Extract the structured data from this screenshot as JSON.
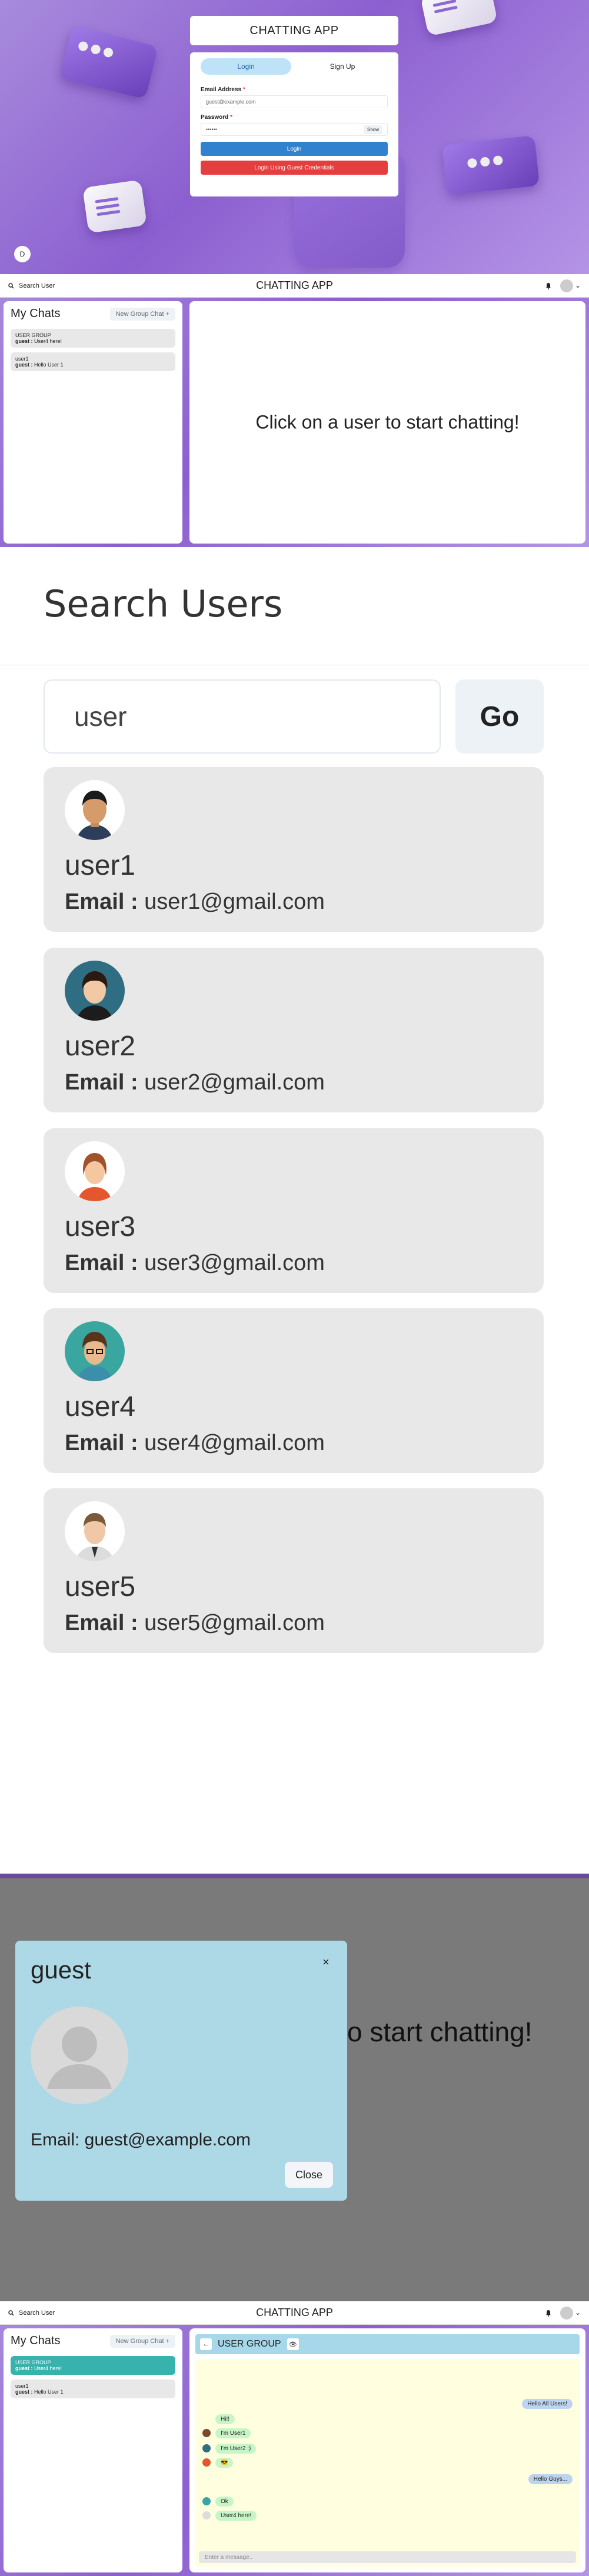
{
  "login": {
    "app_title": "CHATTING APP",
    "tabs": [
      "Login",
      "Sign Up"
    ],
    "email_label": "Email Address",
    "email_value": "guest@example.com",
    "password_label": "Password",
    "password_value": "••••••",
    "show_label": "Show",
    "login_button": "Login",
    "guest_button": "Login Using Guest Credentials",
    "required_mark": "*",
    "corner_icon": "D"
  },
  "topbar": {
    "search_label": "Search User",
    "title": "CHATTING APP",
    "bell_icon": "bell-icon",
    "avatar_icon": "avatar-icon",
    "chevron": "⌄"
  },
  "mychats": {
    "heading": "My Chats",
    "new_group_button": "New Group Chat +",
    "items": [
      {
        "name": "USER GROUP",
        "sender": "guest :",
        "message": "User4 here!"
      },
      {
        "name": "user1",
        "sender": "guest :",
        "message": "Hello User 1"
      }
    ]
  },
  "chatbox": {
    "placeholder": "Click on a user to start chatting!"
  },
  "search_users": {
    "title": "Search Users",
    "query": "user",
    "go_button": "Go",
    "email_label": "Email :",
    "results": [
      {
        "name": "user1",
        "email": "user1@gmail.com"
      },
      {
        "name": "user2",
        "email": "user2@gmail.com"
      },
      {
        "name": "user3",
        "email": "user3@gmail.com"
      },
      {
        "name": "user4",
        "email": "user4@gmail.com"
      },
      {
        "name": "user5",
        "email": "user5@gmail.com"
      }
    ]
  },
  "profile_modal": {
    "name": "guest",
    "email": "Email: guest@example.com",
    "close_button": "Close",
    "close_icon": "×",
    "background_text": "o start chatting!"
  },
  "group_chat": {
    "back_icon": "←",
    "title": "USER GROUP",
    "eye_icon": "👁",
    "messages": [
      {
        "side": "r",
        "text": "Hello All Users!"
      },
      {
        "side": "l",
        "text": "Hi!!"
      },
      {
        "side": "l",
        "text": "I'm User1"
      },
      {
        "side": "l",
        "text": "I'm User2 :)"
      },
      {
        "side": "l",
        "text": "😎"
      },
      {
        "side": "r",
        "text": "Hello Guys..."
      },
      {
        "side": "l",
        "text": "Ok"
      },
      {
        "side": "l",
        "text": "User4 here!"
      }
    ],
    "input_placeholder": "Enter a message..",
    "chat_items": [
      {
        "name": "USER GROUP",
        "sender": "guest :",
        "message": "User4 here!"
      },
      {
        "name": "user1",
        "sender": "guest :",
        "message": "Hello User 1"
      }
    ]
  },
  "colors": {
    "accent_blue": "#3182ce",
    "danger_red": "#e53e3e",
    "selected_teal": "#38b2ac",
    "modal_bg": "#add8e6",
    "chat_bg": "#ffffe0"
  }
}
